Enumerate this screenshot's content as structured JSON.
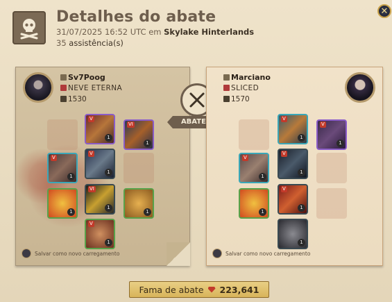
{
  "header": {
    "title": "Detalhes do abate",
    "datetime": "31/07/2025 16:52 UTC",
    "location_prefix": "em",
    "location": "Skylake Hinterlands",
    "assist_count": "35",
    "assist_label": "assistência(s)"
  },
  "killer": {
    "name": "Sv7Poog",
    "guild": "NEVE ETERNA",
    "item_power": "1530",
    "save_label": "Salvar como novo carregamento"
  },
  "victim": {
    "name": "Marciano",
    "guild": "SLICED",
    "item_power": "1570",
    "save_label": "Salvar como novo carregamento"
  },
  "center": {
    "label": "ABATEU"
  },
  "fame": {
    "label": "Fama de abate",
    "value": "223,641"
  },
  "qty": "1",
  "colors": {
    "accent": "#6e5e4d",
    "fame_gold": "#d8b45a",
    "rare_border": "#3aa7b8",
    "epic_border": "#8a5cc8"
  }
}
